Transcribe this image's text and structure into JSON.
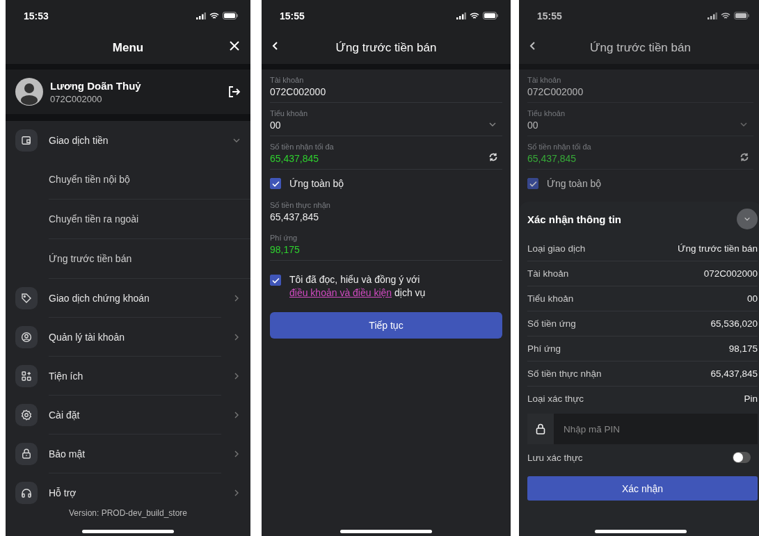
{
  "menu_screen": {
    "status_time": "15:53",
    "title": "Menu",
    "user": {
      "name": "Lương Doãn Thuỷ",
      "account": "072C002000"
    },
    "items": [
      {
        "label": "Giao dịch tiền",
        "expanded": true,
        "children": [
          {
            "label": "Chuyển tiền nội bộ"
          },
          {
            "label": "Chuyển tiền ra ngoài"
          },
          {
            "label": "Ứng trước tiền bán"
          }
        ]
      },
      {
        "label": "Giao dịch chứng khoán",
        "expanded": false
      },
      {
        "label": "Quản lý tài khoản",
        "expanded": false
      },
      {
        "label": "Tiện ích",
        "expanded": false
      },
      {
        "label": "Cài đặt",
        "expanded": false
      },
      {
        "label": "Bảo mật",
        "expanded": false
      },
      {
        "label": "Hỗ trợ",
        "expanded": false
      }
    ],
    "version": "Version: PROD-dev_build_store"
  },
  "advance_screen": {
    "status_time": "15:55",
    "title": "Ứng trước tiền bán",
    "fields": [
      {
        "kind": "plain",
        "label": "Tài khoản",
        "value": "072C002000",
        "highlighted": false
      },
      {
        "kind": "select",
        "label": "Tiểu khoản",
        "value": "00",
        "highlighted": false
      },
      {
        "kind": "refresh",
        "label": "Số tiền nhận tối đa",
        "value": "65,437,845",
        "highlighted": true
      }
    ],
    "advance_all": {
      "label": "Ứng toàn bộ",
      "checked": true
    },
    "results": [
      {
        "label": "Số tiền thực nhận",
        "value": "65,437,845",
        "highlighted": false
      },
      {
        "label": "Phí ứng",
        "value": "98,175",
        "highlighted": true
      }
    ],
    "agreement": {
      "checked": true,
      "text_before": "Tôi đã đọc, hiểu và đồng ý với",
      "link": "điều khoản và điều kiện",
      "text_after": "dịch vụ"
    },
    "continue_button": "Tiếp tục"
  },
  "confirm_screen": {
    "status_time": "15:55",
    "title": "Ứng trước tiền bán",
    "fields": [
      {
        "kind": "plain",
        "label": "Tài khoản",
        "value": "072C002000",
        "highlighted": false
      },
      {
        "kind": "select",
        "label": "Tiểu khoản",
        "value": "00",
        "highlighted": false
      },
      {
        "kind": "refresh",
        "label": "Số tiền nhận tối đa",
        "value": "65,437,845",
        "highlighted": true
      }
    ],
    "advance_all": {
      "label": "Ứng toàn bộ",
      "checked": true
    },
    "sheet": {
      "title": "Xác nhận thông tin",
      "rows": [
        {
          "label": "Loại giao dịch",
          "value": "Ứng trước tiền bán"
        },
        {
          "label": "Tài khoản",
          "value": "072C002000"
        },
        {
          "label": "Tiểu khoản",
          "value": "00"
        },
        {
          "label": "Số tiền ứng",
          "value": "65,536,020"
        },
        {
          "label": "Phí ứng",
          "value": "98,175"
        },
        {
          "label": "Số tiền thực nhận",
          "value": "65,437,845"
        },
        {
          "label": "Loại xác thực",
          "value": "Pin"
        }
      ],
      "pin_placeholder": "Nhập mã PIN",
      "save_auth": {
        "label": "Lưu xác thực",
        "on": false
      },
      "confirm_button": "Xác nhận"
    }
  }
}
